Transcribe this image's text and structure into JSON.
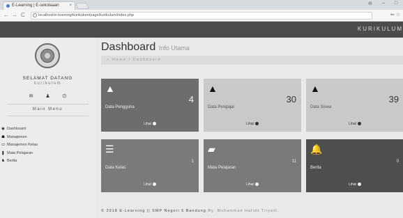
{
  "browser": {
    "tab_title": "E-Learning | E-sekolaaan",
    "tab_close": "×",
    "url": "localhost/e-learning/kurikulum/page/kurikulum/index.php",
    "nav_back": "←",
    "nav_forward": "→",
    "nav_reload": "C",
    "window_controls": [
      "⊖",
      "–",
      "□"
    ],
    "tool_icons": [
      "⇐",
      "☆"
    ]
  },
  "header": {
    "brand": "KURIKULUM"
  },
  "sidebar": {
    "welcome": "SELAMAT DATANG",
    "role": "kurikulum",
    "icons": [
      "envelope-icon",
      "user-icon",
      "power-icon"
    ],
    "icon_glyphs": [
      "✉",
      "♟",
      "⏻"
    ],
    "menu_title": "Main Menu",
    "items": [
      {
        "label": "Dashboard",
        "icon": "dashboard-icon",
        "glyph": "◉"
      },
      {
        "label": "Manajemen",
        "icon": "users-icon",
        "glyph": "☗"
      },
      {
        "label": "Manajemen Kelas",
        "icon": "class-icon",
        "glyph": "▭"
      },
      {
        "label": "Mata Pelajaran",
        "icon": "book-icon",
        "glyph": "❚"
      },
      {
        "label": "Berita",
        "icon": "bell-icon",
        "glyph": "♞"
      }
    ]
  },
  "main": {
    "title": "Dashboard",
    "subtitle": "Info Utama",
    "breadcrumb_home": "Home",
    "breadcrumb_sep": "/",
    "breadcrumb_current": "Dashboard",
    "cards": [
      {
        "label": "Data Pengguna",
        "count": "4",
        "more": "Lihat",
        "icon": "user-icon",
        "glyph": "▲"
      },
      {
        "label": "Data Pengajar",
        "count": "30",
        "more": "Lihat",
        "icon": "user-icon",
        "glyph": "▲"
      },
      {
        "label": "Data Siswa",
        "count": "39",
        "more": "Lihat",
        "icon": "user-icon",
        "glyph": "▲"
      },
      {
        "label": "Data Kelas",
        "count": "1",
        "more": "Lihat",
        "icon": "list-icon",
        "glyph": "☰"
      },
      {
        "label": "Mata Pelajaran",
        "count": "11",
        "more": "Lihat",
        "icon": "book-icon",
        "glyph": "▰"
      },
      {
        "label": "Berita",
        "count": "0",
        "more": "Lihat",
        "icon": "bell-icon",
        "glyph": "🔔"
      }
    ],
    "footer_prefix": "© 2018 E-Learning || SMP Negeri 5 Bandung",
    "footer_by": "By. Muhammad Hafidz Triyadi."
  },
  "colors": {
    "header_bg": "#4c4c4c",
    "sidebar_bg": "#ececec",
    "card_dark": "#6d6d6d",
    "card_light": "#c9c9c9",
    "card_darker": "#4e4e4e"
  }
}
